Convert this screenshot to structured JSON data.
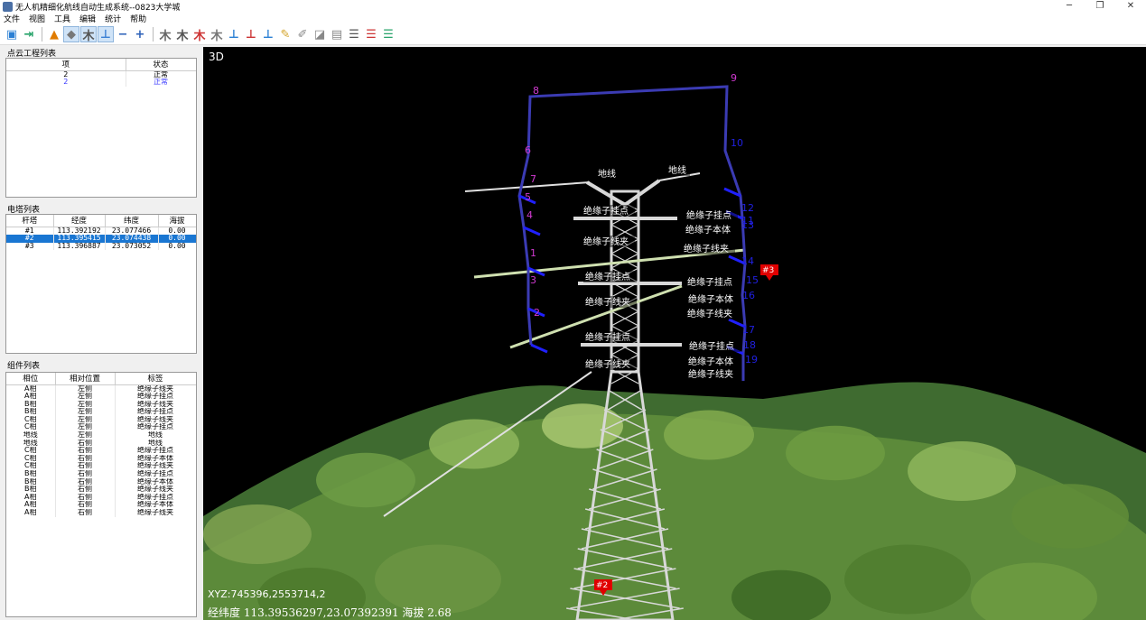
{
  "window": {
    "title": "无人机精细化航线自动生成系统--0823大学城"
  },
  "menu": [
    "文件",
    "视图",
    "工具",
    "编辑",
    "统计",
    "帮助"
  ],
  "pointcloud": {
    "title": "点云工程列表",
    "headers": [
      "项",
      "状态"
    ],
    "rows": [
      [
        "2",
        "正常"
      ],
      [
        "2",
        "正常"
      ]
    ]
  },
  "towers": {
    "title": "电塔列表",
    "headers": [
      "杆塔",
      "经度",
      "纬度",
      "海拔"
    ],
    "rows": [
      [
        "#1",
        "113.392192",
        "23.077466",
        "0.00"
      ],
      [
        "#2",
        "113.395415",
        "23.074438",
        "0.00"
      ],
      [
        "#3",
        "113.396887",
        "23.073052",
        "0.00"
      ]
    ],
    "selected_index": 1
  },
  "components": {
    "title": "组件列表",
    "headers": [
      "相位",
      "相对位置",
      "标签"
    ],
    "rows": [
      [
        "A相",
        "左侧",
        "绝缘子线夹"
      ],
      [
        "A相",
        "左侧",
        "绝缘子挂点"
      ],
      [
        "B相",
        "左侧",
        "绝缘子线夹"
      ],
      [
        "B相",
        "左侧",
        "绝缘子挂点"
      ],
      [
        "C相",
        "左侧",
        "绝缘子线夹"
      ],
      [
        "C相",
        "左侧",
        "绝缘子挂点"
      ],
      [
        "地线",
        "左侧",
        "地线"
      ],
      [
        "地线",
        "右侧",
        "地线"
      ],
      [
        "C相",
        "右侧",
        "绝缘子挂点"
      ],
      [
        "C相",
        "右侧",
        "绝缘子本体"
      ],
      [
        "C相",
        "右侧",
        "绝缘子线夹"
      ],
      [
        "B相",
        "右侧",
        "绝缘子挂点"
      ],
      [
        "B相",
        "右侧",
        "绝缘子本体"
      ],
      [
        "B相",
        "右侧",
        "绝缘子线夹"
      ],
      [
        "A相",
        "右侧",
        "绝缘子挂点"
      ],
      [
        "A相",
        "右侧",
        "绝缘子本体"
      ],
      [
        "A相",
        "右侧",
        "绝缘子线夹"
      ]
    ]
  },
  "viewport": {
    "mode_label": "3D",
    "xyz_text": "XYZ:745396,2553714,2",
    "coord_text": "经纬度 113.39536297,23.07392391 海拔 2.68",
    "tower_markers": [
      "#3",
      "#2"
    ],
    "waypoints": [
      "1",
      "2",
      "3",
      "4",
      "5",
      "6",
      "7",
      "8",
      "9",
      "10",
      "11",
      "12",
      "13",
      "14",
      "15",
      "16",
      "17",
      "18",
      "19"
    ],
    "tower_labels": [
      "地线",
      "地线",
      "绝缘子挂点",
      "绝缘子线夹",
      "绝缘子挂点",
      "绝缘子本体",
      "绝缘子线夹",
      "绝缘子挂点",
      "绝缘子线夹",
      "绝缘子挂点",
      "绝缘子本体",
      "绝缘子线夹",
      "绝缘子挂点",
      "绝缘子线夹",
      "绝缘子挂点",
      "绝缘子本体",
      "绝缘子线夹"
    ],
    "colors": {
      "route": "#3b3bb3",
      "waypoint_label": "#d03ad0",
      "waypoint_label_right": "#2020e0",
      "marker": "#e00000"
    }
  }
}
